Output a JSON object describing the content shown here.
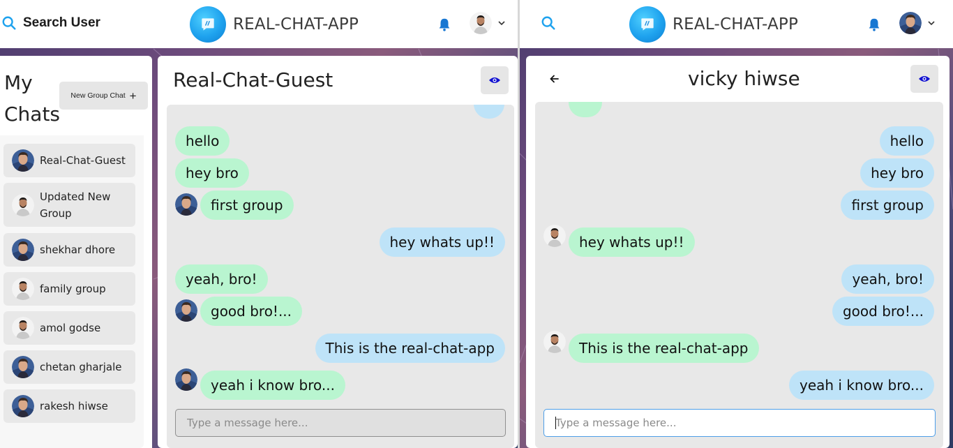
{
  "app": {
    "name": "REAL-CHAT-APP",
    "search_label": "Search User"
  },
  "sidebar": {
    "title": "My Chats",
    "new_group_label": "New Group Chat",
    "chats": [
      {
        "name": "Real-Chat-Guest",
        "avatar": "guest"
      },
      {
        "name": "Updated New Group",
        "avatar": "man"
      },
      {
        "name": "shekhar dhore",
        "avatar": "guest"
      },
      {
        "name": "family group",
        "avatar": "man"
      },
      {
        "name": "amol godse",
        "avatar": "man"
      },
      {
        "name": "chetan gharjale",
        "avatar": "guest"
      },
      {
        "name": "rakesh hiwse",
        "avatar": "guest"
      }
    ]
  },
  "left_chat": {
    "title": "Real-Chat-Guest",
    "input_placeholder": "Type a message here...",
    "messages": [
      {
        "text": "hello",
        "side": "in"
      },
      {
        "text": "hey bro",
        "side": "in"
      },
      {
        "text": "first group",
        "side": "in"
      },
      {
        "text": "hey whats up!!",
        "side": "out"
      },
      {
        "text": "yeah, bro!",
        "side": "in"
      },
      {
        "text": "good bro!...",
        "side": "in"
      },
      {
        "text": "This is the real-chat-app",
        "side": "out"
      },
      {
        "text": "yeah i know bro...",
        "side": "in"
      }
    ]
  },
  "right_chat": {
    "title": "vicky hiwse",
    "input_placeholder": "Type a message here...",
    "messages": [
      {
        "text": "hello",
        "side": "out"
      },
      {
        "text": "hey bro",
        "side": "out"
      },
      {
        "text": "first group",
        "side": "out"
      },
      {
        "text": "hey whats up!!",
        "side": "in"
      },
      {
        "text": "yeah, bro!",
        "side": "out"
      },
      {
        "text": "good bro!...",
        "side": "out"
      },
      {
        "text": "This is the real-chat-app",
        "side": "in"
      },
      {
        "text": "yeah i know bro...",
        "side": "out"
      }
    ]
  },
  "icons": {
    "search": "search-icon",
    "bell": "bell-icon",
    "eye": "eye-icon",
    "back": "arrow-left-icon",
    "chevron": "chevron-down-icon",
    "plus": "plus-icon"
  },
  "colors": {
    "accent": "#1ea2ee",
    "incoming_bubble": "#b9f5d0",
    "outgoing_bubble": "#bee3f8",
    "message_area": "#e8e8e8",
    "eye_icon": "#1010d0"
  }
}
